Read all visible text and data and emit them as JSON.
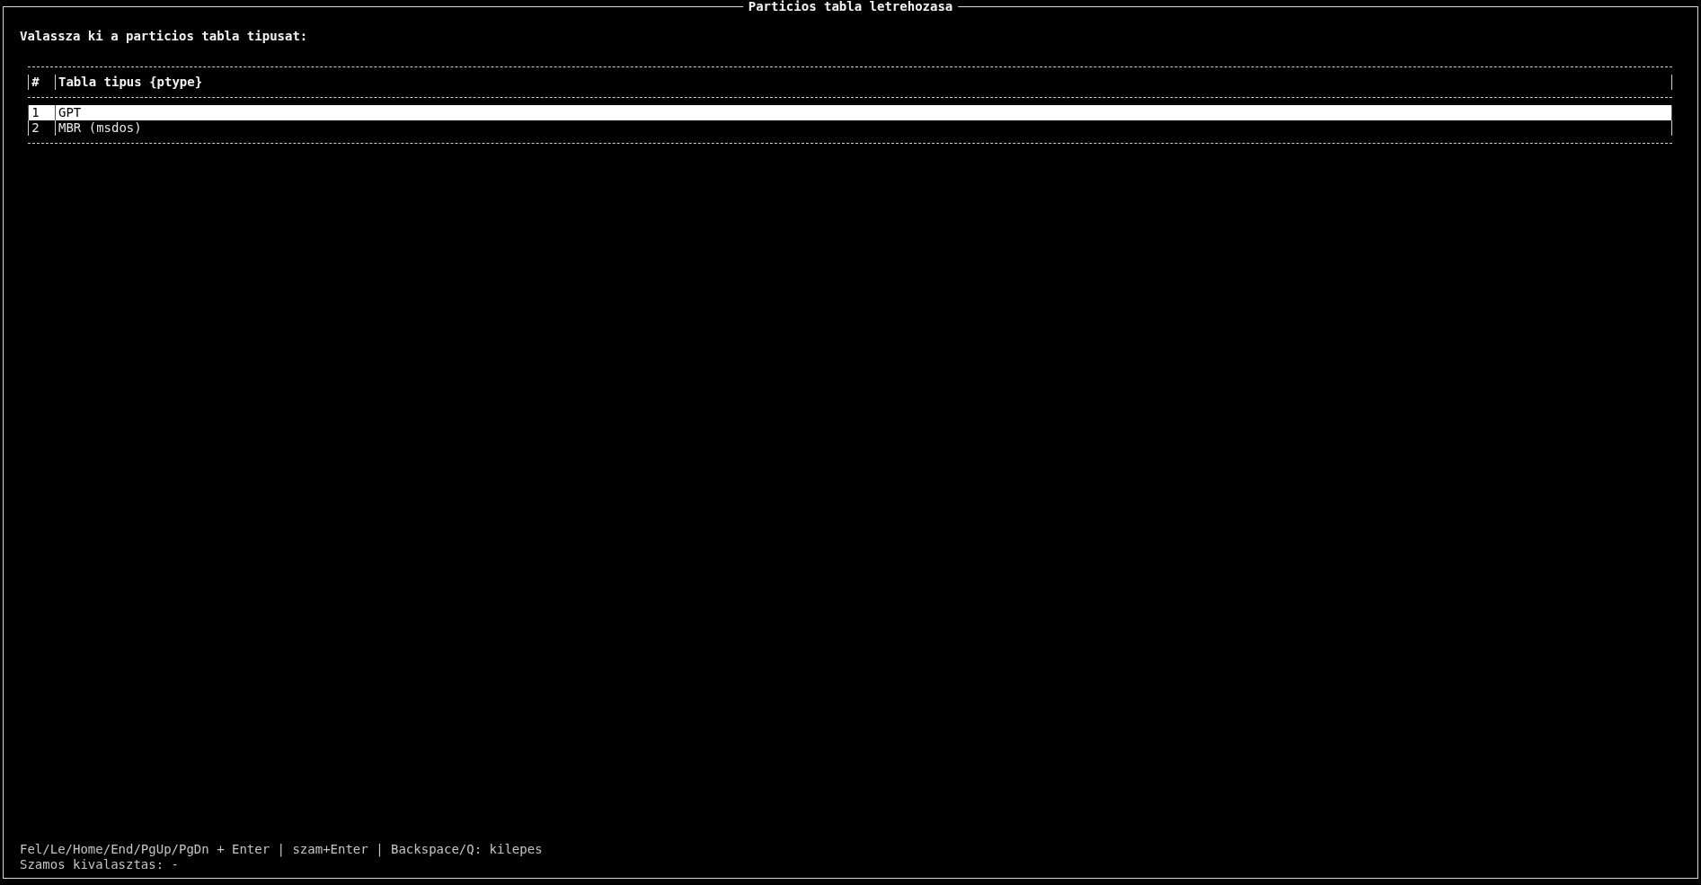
{
  "window": {
    "title": "Particios tabla letrehozasa"
  },
  "prompt": "Valassza ki a particios tabla tipusat:",
  "table": {
    "columns": [
      "#",
      "Tabla tipus {ptype}"
    ],
    "rows": [
      {
        "cells": [
          "1",
          "GPT"
        ],
        "selected": true
      },
      {
        "cells": [
          "2",
          "MBR (msdos)"
        ],
        "selected": false
      }
    ]
  },
  "help_line": "Fel/Le/Home/End/PgUp/PgDn + Enter | szam+Enter | Backspace/Q: kilepes",
  "status_line": "Szamos kivalasztas: -"
}
